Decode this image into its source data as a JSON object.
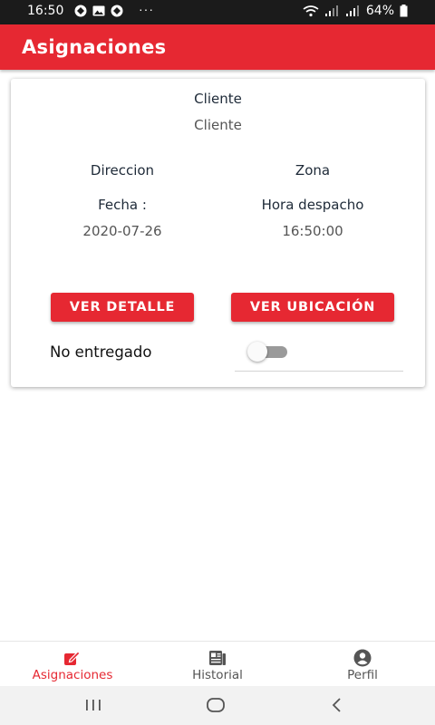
{
  "status_bar": {
    "time": "16:50",
    "more": "···",
    "battery": "64%"
  },
  "app_bar": {
    "title": "Asignaciones"
  },
  "card": {
    "cliente_label": "Cliente",
    "cliente_value": "Cliente",
    "direccion_label": "Direccion",
    "zona_label": "Zona",
    "fecha_label": "Fecha :",
    "fecha_value": "2020-07-26",
    "hora_label": "Hora despacho",
    "hora_value": "16:50:00",
    "detalle_button": "VER DETALLE",
    "ubicacion_button": "VER UBICACIÓN",
    "status_label": "No entregado",
    "delivered": false
  },
  "bottom_nav": {
    "items": [
      {
        "label": "Asignaciones",
        "icon": "edit-icon",
        "active": true
      },
      {
        "label": "Historial",
        "icon": "newspaper-icon",
        "active": false
      },
      {
        "label": "Perfil",
        "icon": "account-circle-icon",
        "active": false
      }
    ]
  },
  "colors": {
    "primary": "#e62832",
    "inactive": "#555555",
    "status_bar": "#1b1b1b"
  }
}
